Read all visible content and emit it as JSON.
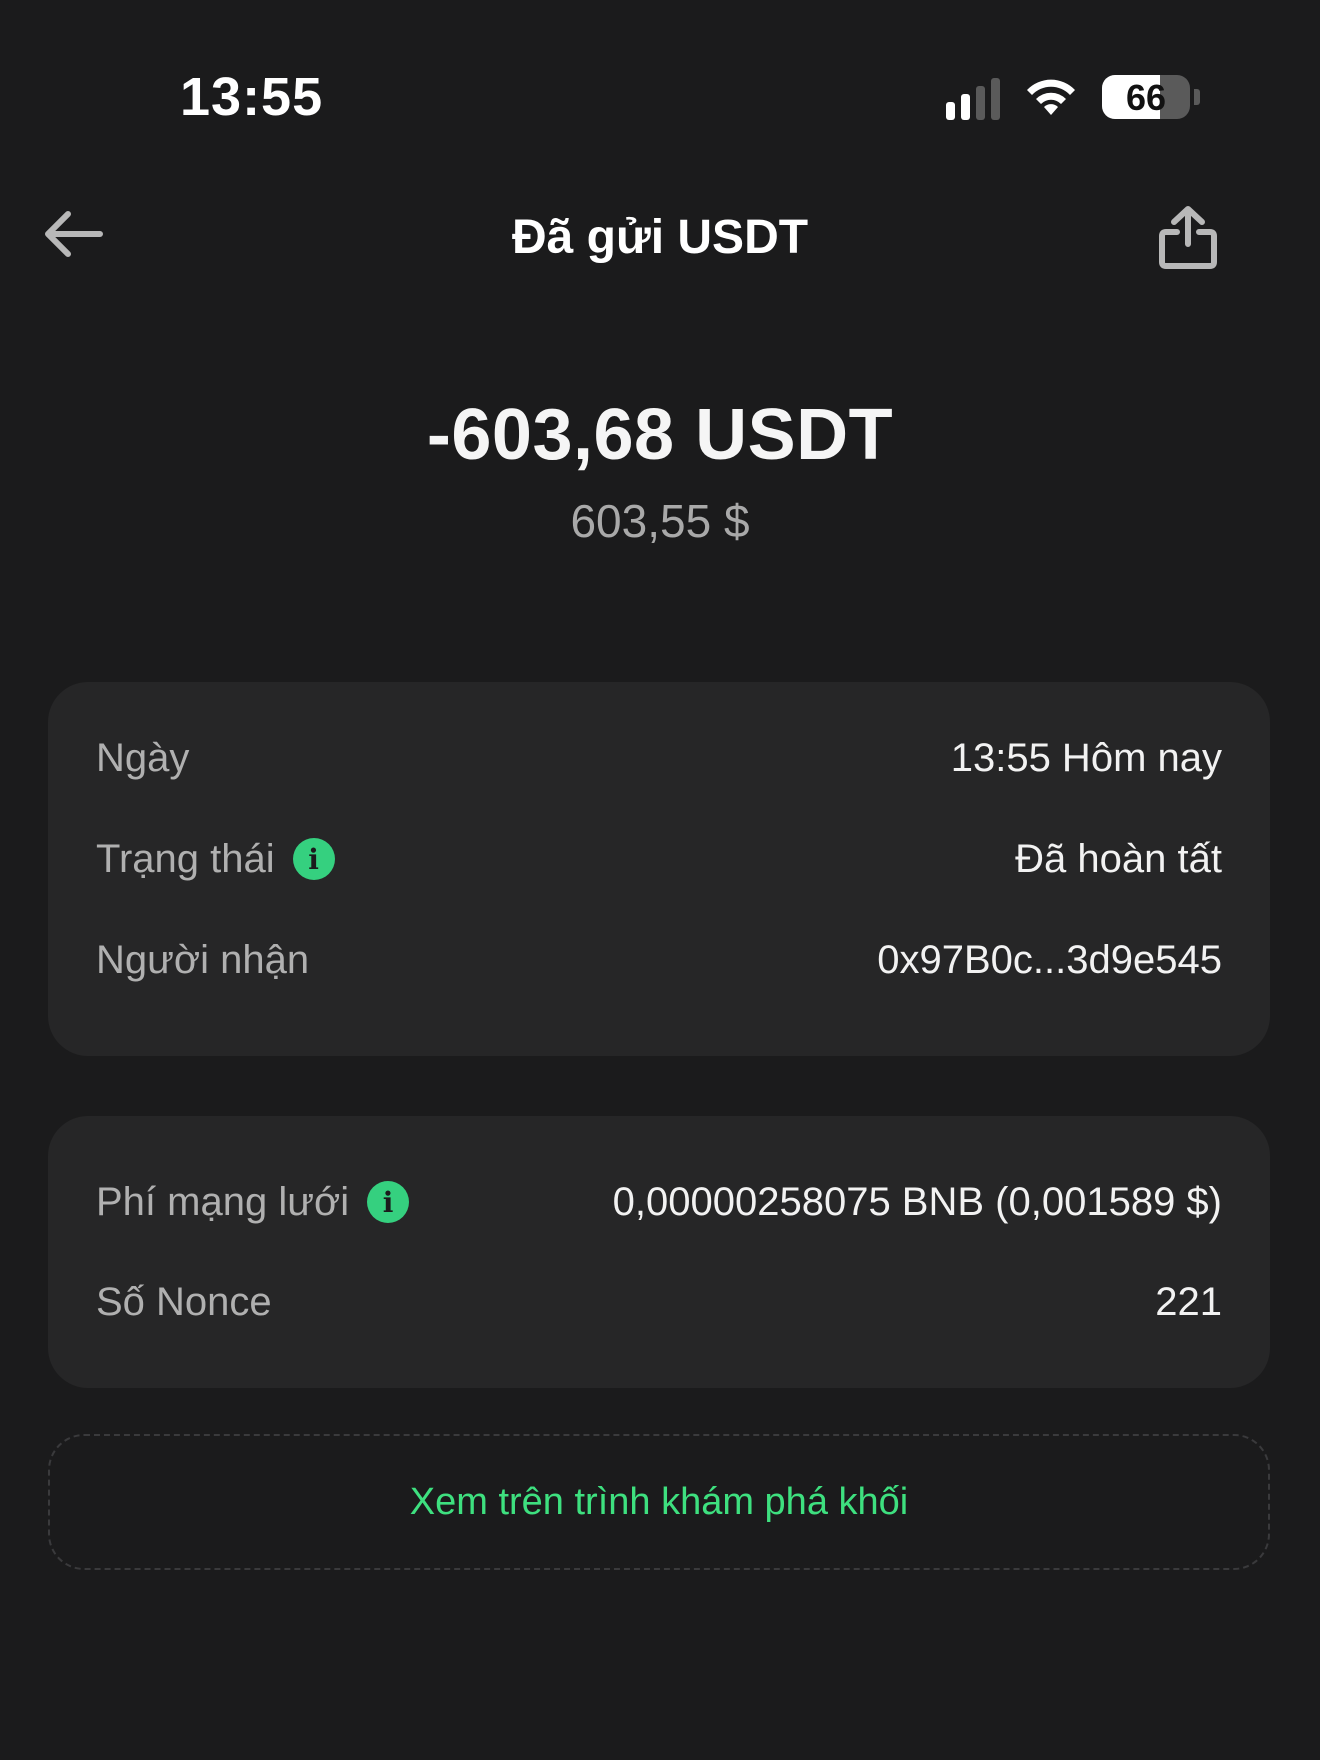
{
  "status_bar": {
    "time": "13:55",
    "battery_level": "66",
    "battery_fraction": 0.66,
    "signal_bars_active": 2,
    "signal_bars_total": 4
  },
  "nav": {
    "title": "Đã gửi USDT",
    "back_icon": "arrow-left-icon",
    "share_icon": "share-icon"
  },
  "transaction": {
    "amount": "-603,68 USDT",
    "fiat_amount": "603,55 $"
  },
  "details": [
    {
      "label": "Ngày",
      "value": "13:55 Hôm nay",
      "info": false
    },
    {
      "label": "Trạng thái",
      "value": "Đã hoàn tất",
      "info": true
    },
    {
      "label": "Người nhận",
      "value": "0x97B0c...3d9e545",
      "info": false
    }
  ],
  "fees": [
    {
      "label": "Phí mạng lưới",
      "value": "0,00000258075 BNB (0,001589 $)",
      "info": true
    },
    {
      "label": "Số Nonce",
      "value": "221",
      "info": false
    }
  ],
  "explorer_link": "Xem trên trình khám phá khối",
  "colors": {
    "background": "#1b1b1c",
    "card": "#262627",
    "accent_green": "#3ee07f",
    "secondary_text": "#b0b0b0"
  }
}
